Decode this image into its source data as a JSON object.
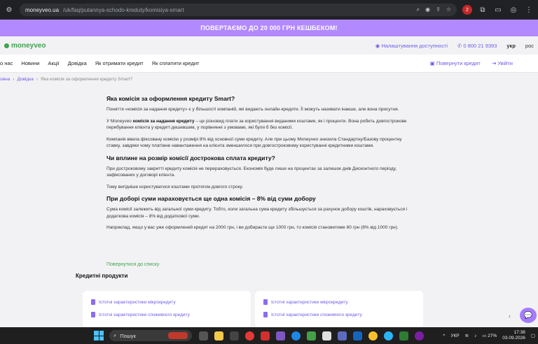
{
  "browser": {
    "url_host": "moneyveo.ua",
    "url_path": "/uk/faq/putannya-schodo-kreduty/komisiya-smart",
    "profile_badge": "2"
  },
  "promo": {
    "text": "ПОВЕРТАЄМО ДО 20 000 ГРН КЕШБЕКОМ!"
  },
  "header": {
    "logo": "moneyveo",
    "accessibility": "Налаштування доступності",
    "phone": "0 800 21 9393",
    "lang_active": "укр",
    "lang_other": "рос"
  },
  "nav": {
    "items": [
      "о нас",
      "Новини",
      "Акції",
      "Довідка",
      "Як отримати кредит",
      "Як сплатити кредит"
    ],
    "return_credit": "Повернути кредит",
    "login": "Увійти"
  },
  "breadcrumb": {
    "home": "овна",
    "help": "Довідка",
    "current": "Яка комісія за оформлення кредиту Smart?"
  },
  "article": {
    "h1": "Яка комісія за оформлення кредиту Smart?",
    "p1": "Поняття «комісія за надання кредиту» є у більшості компаній, які видають онлайн-кредити. Її можуть називати інакше, але вона присутня.",
    "p2_pre": "У Moneyveo ",
    "p2_bold": "комісія за надання кредиту",
    "p2_post": " – це різновид плати за користування виданими коштами, як і проценти. Вона робить довгострокове перебування клієнта у кредиті дешевшим, у порівнянні з умовами, які були б без комісії.",
    "p3": "Компанія ввела фіксовану комісію у розмірі 8% від основної суми кредиту. Але при цьому Moneyveo знизила Стандартну/Базову процентну ставку, завдяки чому платіжне навантаження на клієнта зменшилося при довгостроковому користуванні кредитними коштами.",
    "h2": "Чи вплине на розмір комісії дострокова сплата кредиту?",
    "p4": "При достроковому закритті кредиту комісія не перераховується. Економія буде лише на процентах за залишок днів Дисконтного періоду, зафіксованих у договорі клієнта.",
    "p5": "Тому вигідніше користуватися коштами протягом довгого строку.",
    "h3": "При доборі суми нараховується ще одна комісія – 8% від суми добору",
    "p6": "Сума комісії залежить від загальної суми кредиту. Тобто, коли загальна сума кредиту збільшується за рахунок добору коштів, нараховується і додаткова комісія – 8% від додаткової суми.",
    "p7": "Наприклад, якщо у вас уже оформлений кредит на 2000 грн, і ви добираєте ще 1000 грн, то комісія становитиме 80 грн (8% від 1000 грн).",
    "back": "Повернутися до списку"
  },
  "products": {
    "title": "Кредитні продукти",
    "left": [
      "Істотні характеристики мікрокредиту",
      "Істотні характеристики споживчого кредиту"
    ],
    "right": [
      "Істотні характеристики мікрокредиту",
      "Істотні характеристики споживчого кредиту"
    ]
  },
  "taskbar": {
    "search_placeholder": "Пошук",
    "lang": "УКР",
    "battery": "27%",
    "time": "17:38",
    "date": "03.09.2026"
  },
  "colors": {
    "accent": "#6c5ce7",
    "promo": "#b289ff",
    "brand_green": "#3fa34d"
  }
}
